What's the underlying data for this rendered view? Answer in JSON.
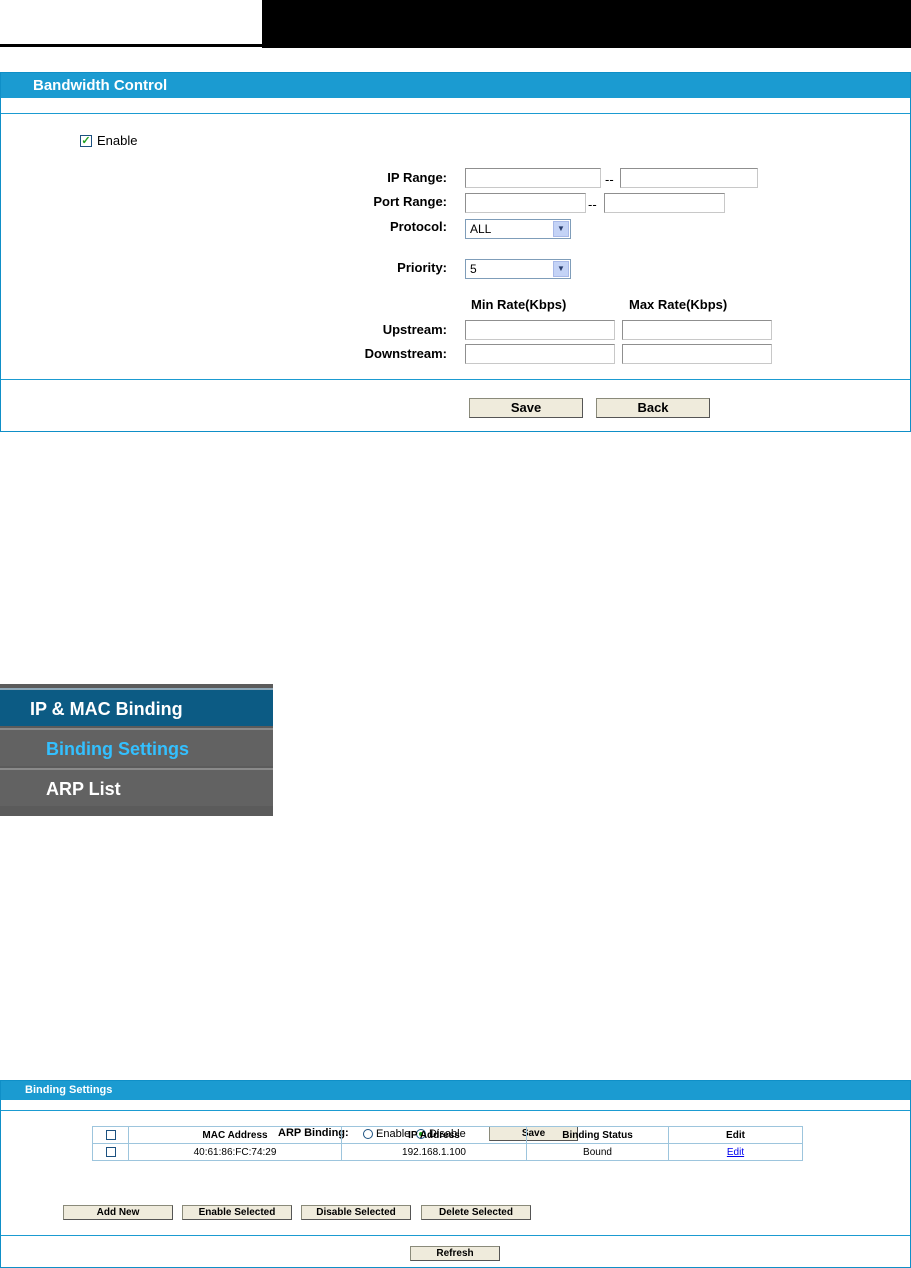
{
  "bandwidth_control": {
    "title": "Bandwidth Control",
    "enable_label": "Enable",
    "enable_checked": true,
    "ip_range_label": "IP Range:",
    "port_range_label": "Port Range:",
    "range_separator": "--",
    "protocol_label": "Protocol:",
    "protocol_value": "ALL",
    "priority_label": "Priority:",
    "priority_value": "5",
    "min_rate_header": "Min Rate(Kbps)",
    "max_rate_header": "Max Rate(Kbps)",
    "upstream_label": "Upstream:",
    "downstream_label": "Downstream:",
    "save_label": "Save",
    "back_label": "Back"
  },
  "menu": {
    "section": "IP & MAC Binding",
    "items": [
      {
        "label": "Binding Settings",
        "active": true
      },
      {
        "label": "ARP List",
        "active": false
      }
    ]
  },
  "binding_settings": {
    "title": "Binding Settings",
    "arp_binding_label": "ARP Binding:",
    "enable_option": "Enable",
    "disable_option": "Disable",
    "selected_option": "Disable",
    "save_label": "Save",
    "columns": [
      "MAC Address",
      "IP Address",
      "Binding Status",
      "Edit"
    ],
    "rows": [
      {
        "mac": "40:61:86:FC:74:29",
        "ip": "192.168.1.100",
        "status": "Bound",
        "edit": "Edit"
      }
    ],
    "add_new_label": "Add New",
    "enable_selected_label": "Enable Selected",
    "disable_selected_label": "Disable Selected",
    "delete_selected_label": "Delete Selected",
    "refresh_label": "Refresh"
  },
  "colors": {
    "panel_header": "#1b9bd1",
    "menu_active_bg": "#0c5b84",
    "menu_active_text": "#33c0ff",
    "menu_bg": "#5b5b5b"
  }
}
